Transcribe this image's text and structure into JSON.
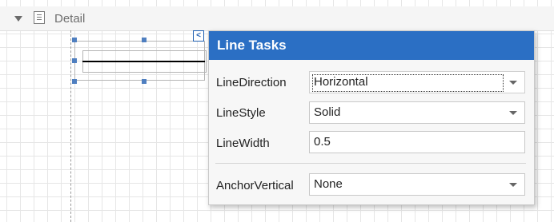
{
  "band": {
    "title": "Detail",
    "caret_icon": "triangle-down-icon",
    "band_icon": "document-icon"
  },
  "smart_tag": {
    "glyph": "<",
    "icon": "chevron-left-icon"
  },
  "panel": {
    "title": "Line Tasks",
    "accent": "#2b6fc4",
    "rows": {
      "line_direction": {
        "label": "LineDirection",
        "value": "Horizontal"
      },
      "line_style": {
        "label": "LineStyle",
        "value": "Solid"
      },
      "line_width": {
        "label": "LineWidth",
        "value": "0.5"
      },
      "anchor_vertical": {
        "label": "AnchorVertical",
        "value": "None"
      }
    }
  }
}
